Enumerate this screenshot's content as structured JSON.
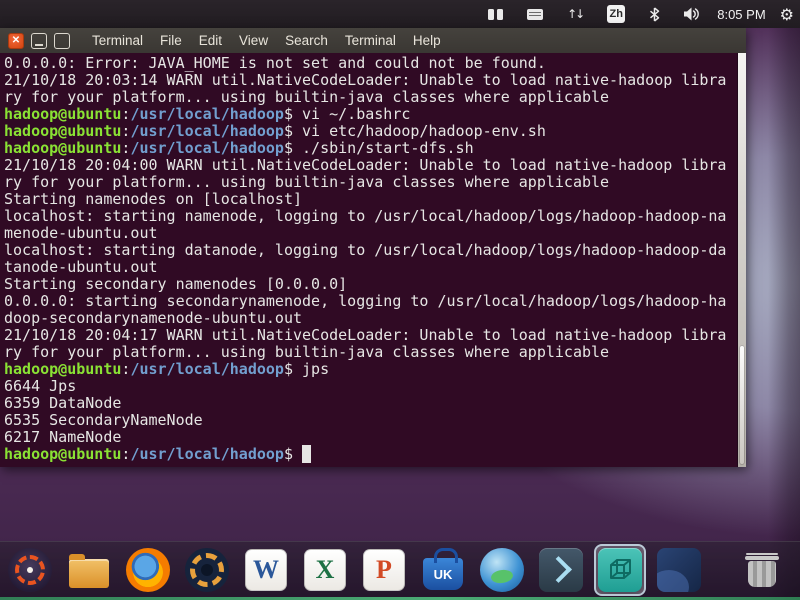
{
  "topbar": {
    "time": "8:05 PM",
    "input_method_label": "Zh",
    "indicators": [
      "panels-icon",
      "keyboard-icon",
      "network-arrows-icon",
      "input-method-badge",
      "bluetooth-icon",
      "volume-icon",
      "clock-text",
      "settings-gear-icon"
    ]
  },
  "window": {
    "menu": [
      "Terminal",
      "File",
      "Edit",
      "View",
      "Search",
      "Terminal",
      "Help"
    ]
  },
  "terminal": {
    "lines": [
      [
        {
          "t": "0.0.0.0: Error: JAVA_HOME is not set and could not be found."
        }
      ],
      [
        {
          "t": "21/10/18 20:03:14 WARN util.NativeCodeLoader: Unable to load native-hadoop libra"
        }
      ],
      [
        {
          "t": "ry for your platform... using builtin-java classes where applicable"
        }
      ],
      [
        {
          "t": "hadoop@ubuntu",
          "c": "g"
        },
        {
          "t": ":"
        },
        {
          "t": "/usr/local/hadoop",
          "c": "b"
        },
        {
          "t": "$ vi ~/.bashrc"
        }
      ],
      [
        {
          "t": "hadoop@ubuntu",
          "c": "g"
        },
        {
          "t": ":"
        },
        {
          "t": "/usr/local/hadoop",
          "c": "b"
        },
        {
          "t": "$ vi etc/hadoop/hadoop-env.sh"
        }
      ],
      [
        {
          "t": "hadoop@ubuntu",
          "c": "g"
        },
        {
          "t": ":"
        },
        {
          "t": "/usr/local/hadoop",
          "c": "b"
        },
        {
          "t": "$ ./sbin/start-dfs.sh"
        }
      ],
      [
        {
          "t": "21/10/18 20:04:00 WARN util.NativeCodeLoader: Unable to load native-hadoop libra"
        }
      ],
      [
        {
          "t": "ry for your platform... using builtin-java classes where applicable"
        }
      ],
      [
        {
          "t": "Starting namenodes on [localhost]"
        }
      ],
      [
        {
          "t": "localhost: starting namenode, logging to /usr/local/hadoop/logs/hadoop-hadoop-na"
        }
      ],
      [
        {
          "t": "menode-ubuntu.out"
        }
      ],
      [
        {
          "t": "localhost: starting datanode, logging to /usr/local/hadoop/logs/hadoop-hadoop-da"
        }
      ],
      [
        {
          "t": "tanode-ubuntu.out"
        }
      ],
      [
        {
          "t": "Starting secondary namenodes [0.0.0.0]"
        }
      ],
      [
        {
          "t": "0.0.0.0: starting secondarynamenode, logging to /usr/local/hadoop/logs/hadoop-ha"
        }
      ],
      [
        {
          "t": "doop-secondarynamenode-ubuntu.out"
        }
      ],
      [
        {
          "t": "21/10/18 20:04:17 WARN util.NativeCodeLoader: Unable to load native-hadoop libra"
        }
      ],
      [
        {
          "t": "ry for your platform... using builtin-java classes where applicable"
        }
      ],
      [
        {
          "t": "hadoop@ubuntu",
          "c": "g"
        },
        {
          "t": ":"
        },
        {
          "t": "/usr/local/hadoop",
          "c": "b"
        },
        {
          "t": "$ jps"
        }
      ],
      [
        {
          "t": "6644 Jps"
        }
      ],
      [
        {
          "t": "6359 DataNode"
        }
      ],
      [
        {
          "t": "6535 SecondaryNameNode"
        }
      ],
      [
        {
          "t": "6217 NameNode"
        }
      ],
      [
        {
          "t": "hadoop@ubuntu",
          "c": "g"
        },
        {
          "t": ":"
        },
        {
          "t": "/usr/local/hadoop",
          "c": "b"
        },
        {
          "t": "$ "
        },
        {
          "t": " ",
          "c": "cursor"
        }
      ]
    ]
  },
  "dock": {
    "items": [
      {
        "key": "ubuntu",
        "icon": "ubuntu-logo-icon"
      },
      {
        "key": "files",
        "icon": "folder-icon"
      },
      {
        "key": "firefox",
        "icon": "firefox-icon"
      },
      {
        "key": "lens",
        "icon": "camera-lens-icon"
      },
      {
        "key": "word",
        "icon": "word-icon",
        "glyph": "W"
      },
      {
        "key": "excel",
        "icon": "excel-icon",
        "glyph": "X"
      },
      {
        "key": "powerpoint",
        "icon": "powerpoint-icon",
        "glyph": "P"
      },
      {
        "key": "kylin-store",
        "icon": "shopping-bag-icon",
        "glyph": "UK"
      },
      {
        "key": "youker",
        "icon": "globe-app-icon"
      },
      {
        "key": "launcher",
        "icon": "chevron-right-icon"
      },
      {
        "key": "boxes",
        "icon": "cube-icon",
        "active": true
      },
      {
        "key": "blueapp",
        "icon": "dark-blue-app-icon"
      },
      {
        "key": "trash",
        "icon": "trash-icon"
      }
    ]
  },
  "colors": {
    "terminal_bg": "#300a24",
    "prompt_green": "#8ae234",
    "path_blue": "#729fcf",
    "close_button_orange": "#e95420",
    "active_selection_border": "#d2e8f2"
  }
}
